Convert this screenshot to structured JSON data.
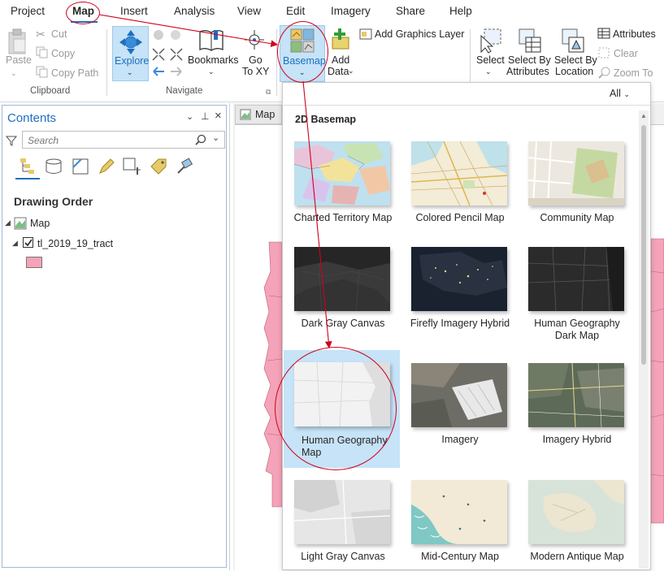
{
  "menu": {
    "items": [
      "Project",
      "Map",
      "Insert",
      "Analysis",
      "View",
      "Edit",
      "Imagery",
      "Share",
      "Help"
    ],
    "active": "Map"
  },
  "ribbon": {
    "clipboard": {
      "paste": "Paste",
      "cut": "Cut",
      "copy": "Copy",
      "copy_path": "Copy Path",
      "group": "Clipboard"
    },
    "navigate": {
      "explore": "Explore",
      "bookmarks": "Bookmarks",
      "goto_line1": "Go",
      "goto_line2": "To XY",
      "group": "Navigate"
    },
    "layer": {
      "basemap": "Basemap",
      "add_data_line1": "Add",
      "add_data_line2": "Data",
      "add_graphics": "Add Graphics Layer"
    },
    "selection": {
      "select": "Select",
      "select_by_attr_line1": "Select By",
      "select_by_attr_line2": "Attributes",
      "select_by_loc_line1": "Select By",
      "select_by_loc_line2": "Location",
      "attributes": "Attributes",
      "clear": "Clear",
      "zoom_to": "Zoom To"
    }
  },
  "contents": {
    "title": "Contents",
    "search_placeholder": "Search",
    "drawing_order": "Drawing Order",
    "map_node": "Map",
    "layer_name": "tl_2019_19_tract",
    "symbol_color": "#f4a3b8"
  },
  "map_tab": {
    "label": "Map"
  },
  "gallery": {
    "filter": "All",
    "section": "2D Basemap",
    "items": [
      {
        "line1": "Charted Territory Map",
        "line2": ""
      },
      {
        "line1": "Colored Pencil Map",
        "line2": ""
      },
      {
        "line1": "Community Map",
        "line2": ""
      },
      {
        "line1": "Dark Gray Canvas",
        "line2": ""
      },
      {
        "line1": "Firefly Imagery Hybrid",
        "line2": ""
      },
      {
        "line1": "Human Geography",
        "line2": "Dark Map"
      },
      {
        "line1": "Human Geography",
        "line2": "Map"
      },
      {
        "line1": "Imagery",
        "line2": ""
      },
      {
        "line1": "Imagery Hybrid",
        "line2": ""
      },
      {
        "line1": "Light Gray Canvas",
        "line2": ""
      },
      {
        "line1": "Mid-Century Map",
        "line2": ""
      },
      {
        "line1": "Modern Antique Map",
        "line2": ""
      }
    ],
    "selected_index": 6
  },
  "colors": {
    "accent": "#1e6fbf",
    "selected_bg": "#c6e3f7",
    "annotation": "#d0021b",
    "pink_polygons": "#f4a3b8"
  }
}
